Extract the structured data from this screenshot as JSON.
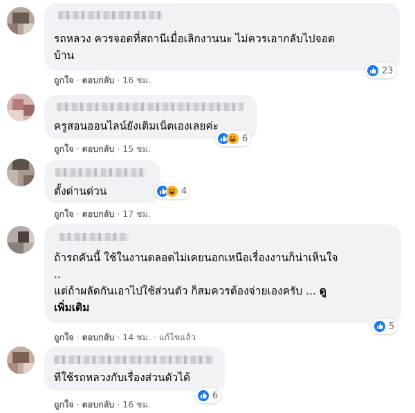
{
  "comments": [
    {
      "text": "รถหลวง ควรจอดที่สถานีเมื่อเลิกงานนะ ไม่ควรเอากลับไปจอด\nบ้าน",
      "like_label": "ถูกใจ",
      "reply_label": "ตอบกลับ",
      "time": "16 ชม.",
      "reaction_count": "23",
      "reactions": [
        "like-icon"
      ]
    },
    {
      "text": "ครูสอนออนไลน์ยังเติมเน็ตเองเลยค่ะ",
      "like_label": "ถูกใจ",
      "reply_label": "ตอบกลับ",
      "time": "15 ชม.",
      "reaction_count": "6",
      "reactions": [
        "like-icon",
        "haha-icon"
      ]
    },
    {
      "text": "ตั้งด่านด่วน",
      "like_label": "ถูกใจ",
      "reply_label": "ตอบกลับ",
      "time": "17 ชม.",
      "reaction_count": "4",
      "reactions": [
        "like-icon",
        "haha-icon"
      ]
    },
    {
      "text": "ถ้ารถคันนี้ ใช้ในงานตลอดไม่เคยนอกเหนือเรื่องงานก็น่าเห็นใจ\n..\nแต่ถ้าผลัดกันเอาไปใช้ส่วนตัว ก็สมควรต้องจ่ายเองครับ ...",
      "see_more_1": "ดู",
      "see_more_2": "เพิ่มเติม",
      "like_label": "ถูกใจ",
      "reply_label": "ตอบกลับ",
      "time": "14 ชม.",
      "edited_label": "แก้ไขแล้ว",
      "reaction_count": "5",
      "reactions": [
        "like-icon"
      ]
    },
    {
      "text": "ทีใช้รถหลวงกับเรื่องส่วนตัวได้",
      "like_label": "ถูกใจ",
      "reply_label": "ตอบกลับ",
      "time": "16 ชม.",
      "reaction_count": "6",
      "reactions": [
        "like-icon"
      ]
    }
  ],
  "colors": {
    "bubble": "#f0f2f5",
    "meta_text": "#65676b",
    "like_blue": "#1877f2",
    "haha_yellow": "#f7b125"
  }
}
